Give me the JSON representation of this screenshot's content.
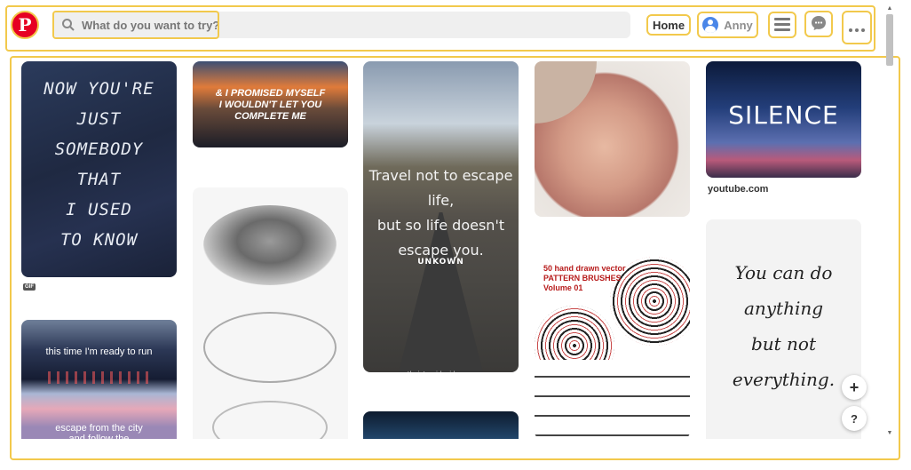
{
  "header": {
    "search_placeholder": "What do you want to try?",
    "home_label": "Home",
    "user_name": "Anny",
    "icons": [
      "pinterest-logo",
      "search-icon",
      "menu-icon",
      "chat-icon",
      "more-icon"
    ]
  },
  "pins": {
    "p1_text": "NOW YOU'RE\nJUST\nSOMEBODY\nTHAT\nI USED\nTO KNOW",
    "p1_badge": "GIF",
    "p2_line1": "this time I'm ready to run",
    "p2_line2": "escape from the city\nand follow the",
    "p3_text": "& I PROMISED MYSELF\nI WOULDN'T LET YOU\nCOMPLETE ME",
    "p5_text": "Travel not to escape life,\nbut so life doesn't\nescape you.",
    "p5_author": "UNKOWN",
    "p5_credit": "theintrepidguide.com",
    "p8_text": "50 hand drawn vector\nPATTERN BRUSHES\nVolume 01",
    "p10_text": "SILENCE",
    "p10_source": "youtube.com",
    "p11_text": "You can do\nanything\nbut not\neverything."
  },
  "floating": {
    "add": "+",
    "help": "?"
  },
  "colors": {
    "brand": "#e60023",
    "highlight": "#f2c94c"
  }
}
